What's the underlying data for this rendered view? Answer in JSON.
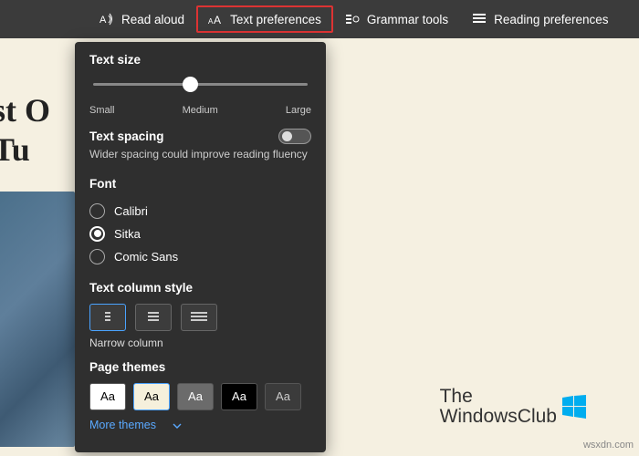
{
  "toolbar": {
    "read_aloud": "Read aloud",
    "text_prefs": "Text preferences",
    "grammar": "Grammar tools",
    "reading_prefs": "Reading preferences"
  },
  "page": {
    "heading_line1": "st O",
    "heading_line2": "  Tu"
  },
  "panel": {
    "text_size": {
      "title": "Text size",
      "small": "Small",
      "medium": "Medium",
      "large": "Large"
    },
    "text_spacing": {
      "title": "Text spacing",
      "desc": "Wider spacing could improve reading fluency"
    },
    "font": {
      "title": "Font",
      "options": [
        "Calibri",
        "Sitka",
        "Comic Sans"
      ],
      "selected": "Sitka"
    },
    "column_style": {
      "title": "Text column style",
      "caption": "Narrow column"
    },
    "page_themes": {
      "title": "Page themes",
      "swatch_label": "Aa",
      "themes": [
        {
          "bg": "#ffffff",
          "fg": "#000000",
          "active": false
        },
        {
          "bg": "#f5f0dc",
          "fg": "#000000",
          "active": true
        },
        {
          "bg": "#6b6b6b",
          "fg": "#ffffff",
          "active": false
        },
        {
          "bg": "#000000",
          "fg": "#ffffff",
          "active": false
        },
        {
          "bg": "#3b3b3b",
          "fg": "#cccccc",
          "active": false
        }
      ],
      "more": "More themes"
    }
  },
  "brand": {
    "line1": "The",
    "line2": "WindowsClub"
  },
  "watermark": "wsxdn.com"
}
